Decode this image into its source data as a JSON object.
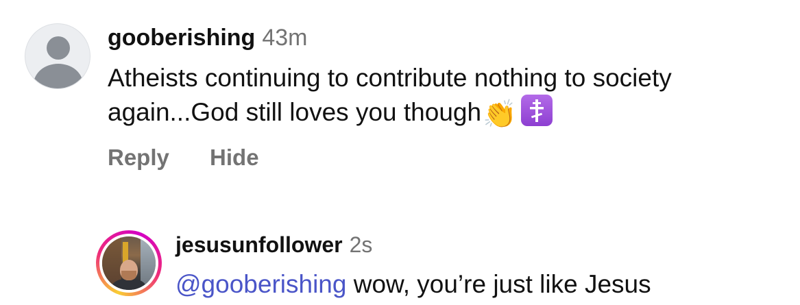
{
  "comments": [
    {
      "username": "gooberishing",
      "time": "43m",
      "text": "Atheists continuing to contribute nothing to society again...God still loves you though",
      "emoji_clap": "👏",
      "icon_cross": "orthodox-cross-icon",
      "avatar": "default-avatar",
      "actions": {
        "reply": "Reply",
        "hide": "Hide"
      }
    },
    {
      "username": "jesusunfollower",
      "time": "2s",
      "mention": "@gooberishing",
      "text": " wow, you’re just like Jesus",
      "avatar": "profile-photo-story-ring"
    }
  ],
  "colors": {
    "text": "#111111",
    "muted": "#737373",
    "mention": "#4a55c8",
    "cross_bg": "#9b4fdc",
    "story_ring_start": "#f9ce34",
    "story_ring_mid": "#ee2a7b",
    "story_ring_end": "#d300c5"
  }
}
